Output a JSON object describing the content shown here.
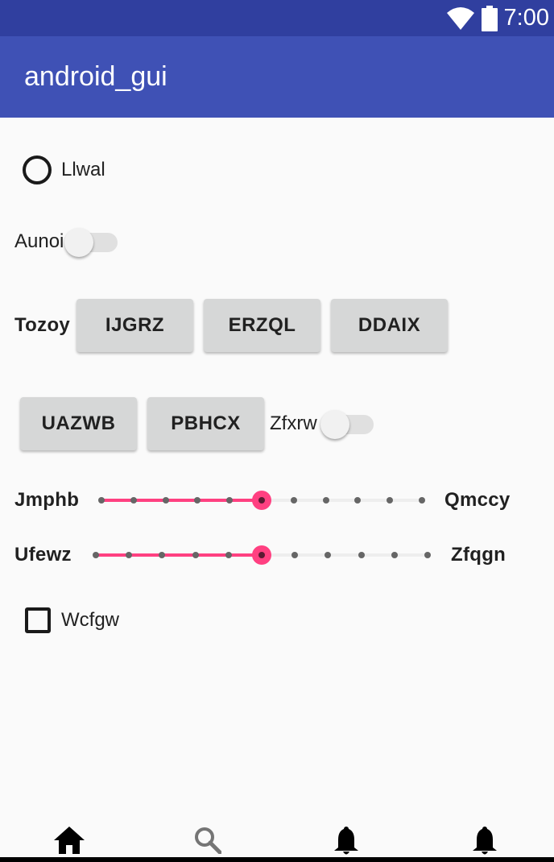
{
  "status_bar": {
    "time": "7:00",
    "icons": [
      "wifi-icon",
      "battery-icon"
    ]
  },
  "app_bar": {
    "title": "android_gui"
  },
  "radio": {
    "label": "Llwal",
    "checked": false
  },
  "switch_1": {
    "label": "Aunoi",
    "on": false
  },
  "row_buttons_1": {
    "label": "Tozoy",
    "buttons": [
      "IJGRZ",
      "ERZQL",
      "DDAIX"
    ]
  },
  "row_buttons_2": {
    "buttons": [
      "UAZWB",
      "PBHCX"
    ],
    "switch_label": "Zfxrw",
    "switch_on": false
  },
  "slider_1": {
    "left_label": "Jmphb",
    "right_label": "Qmccy",
    "value": 5,
    "max": 10
  },
  "slider_2": {
    "left_label": "Ufewz",
    "right_label": "Zfqgn",
    "value": 5,
    "max": 10
  },
  "checkbox": {
    "label": "Wcfgw",
    "checked": false
  },
  "bottom_nav": {
    "items": [
      "home-icon",
      "search-icon",
      "notifications-icon",
      "notifications-icon"
    ],
    "selected": 0
  },
  "colors": {
    "status_bar": "#303f9f",
    "app_bar": "#3f51b5",
    "accent": "#ff4081",
    "background": "#fafafa"
  }
}
